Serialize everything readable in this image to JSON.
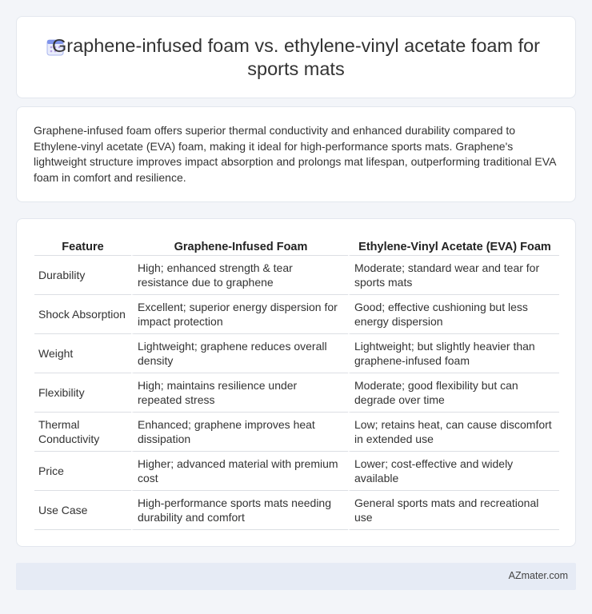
{
  "title": "Graphene-infused foam vs. ethylene-vinyl acetate foam for sports mats",
  "icon": "calendar-icon",
  "intro": "Graphene-infused foam offers superior thermal conductivity and enhanced durability compared to Ethylene-vinyl acetate (EVA) foam, making it ideal for high-performance sports mats. Graphene's lightweight structure improves impact absorption and prolongs mat lifespan, outperforming traditional EVA foam in comfort and resilience.",
  "table": {
    "headers": [
      "Feature",
      "Graphene-Infused Foam",
      "Ethylene-Vinyl Acetate (EVA) Foam"
    ],
    "rows": [
      [
        "Durability",
        "High; enhanced strength & tear resistance due to graphene",
        "Moderate; standard wear and tear for sports mats"
      ],
      [
        "Shock Absorption",
        "Excellent; superior energy dispersion for impact protection",
        "Good; effective cushioning but less energy dispersion"
      ],
      [
        "Weight",
        "Lightweight; graphene reduces overall density",
        "Lightweight; but slightly heavier than graphene-infused foam"
      ],
      [
        "Flexibility",
        "High; maintains resilience under repeated stress",
        "Moderate; good flexibility but can degrade over time"
      ],
      [
        "Thermal Conductivity",
        "Enhanced; graphene improves heat dissipation",
        "Low; retains heat, can cause discomfort in extended use"
      ],
      [
        "Price",
        "Higher; advanced material with premium cost",
        "Lower; cost-effective and widely available"
      ],
      [
        "Use Case",
        "High-performance sports mats needing durability and comfort",
        "General sports mats and recreational use"
      ]
    ]
  },
  "footer": "AZmater.com",
  "colors": {
    "background": "#f3f5f9",
    "card": "#ffffff",
    "footer_bg": "#e6ebf5",
    "icon_accent": "#7a8ee8"
  }
}
